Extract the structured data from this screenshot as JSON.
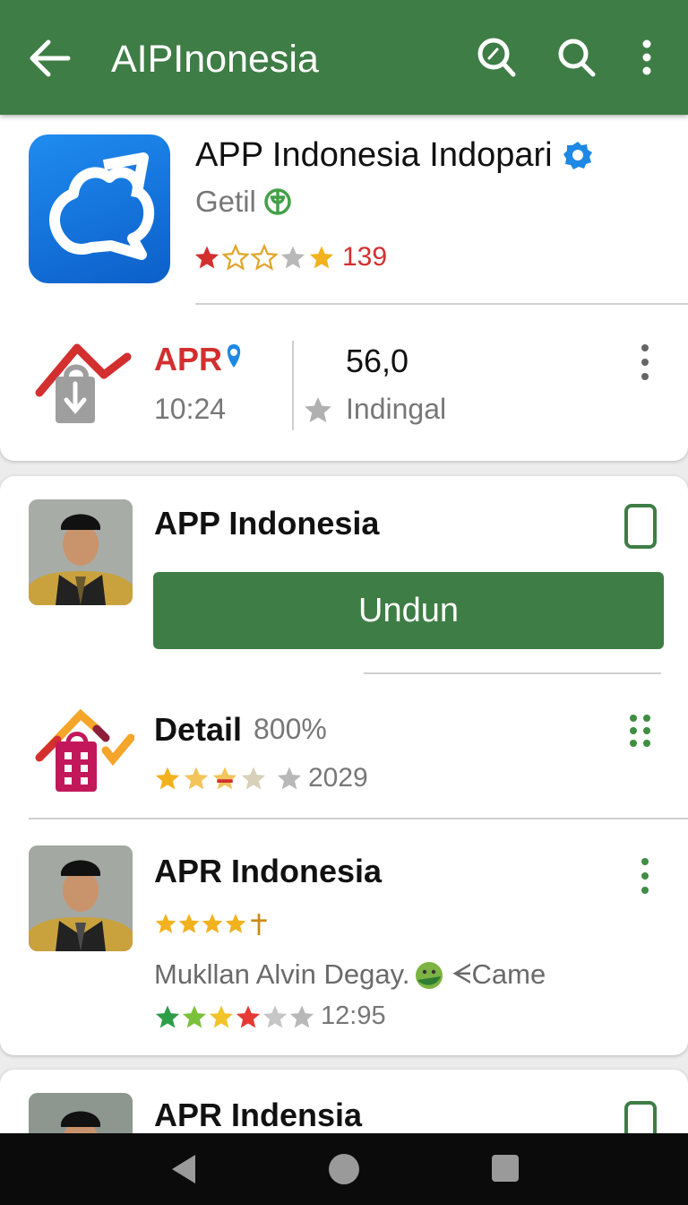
{
  "appbar": {
    "title": "AIPInonesia"
  },
  "featured": {
    "name": "APP Indonesia Indopari",
    "developer": "Getil",
    "rating_count": "139",
    "stat_label": "APR",
    "stat_time": "10:24",
    "stat_value": "56,0",
    "stat_caption": "Indingal"
  },
  "list": {
    "item1": {
      "title": "APP Indonesia",
      "button": "Undun"
    },
    "item2": {
      "title": "Detail",
      "percent": "800%",
      "rating_count": "2029"
    },
    "item3": {
      "title": "APR Indonesia",
      "subtitle": "Mukllan Alvin Degay.",
      "tag": "ᗕCame",
      "time": "12:95"
    },
    "item4": {
      "title": "APR Indensia"
    }
  },
  "colors": {
    "primary": "#3e7d45",
    "accent_red": "#d32f2f",
    "star_gold": "#f2b21d",
    "verified_blue": "#1e88e5"
  },
  "icons": [
    "back-arrow-icon",
    "compass-search-icon",
    "search-icon",
    "more-vert-icon",
    "verified-badge-icon",
    "app-logo-icon",
    "house-lock-icon",
    "star-icon",
    "checkbox-icon",
    "grid-dots-icon"
  ]
}
